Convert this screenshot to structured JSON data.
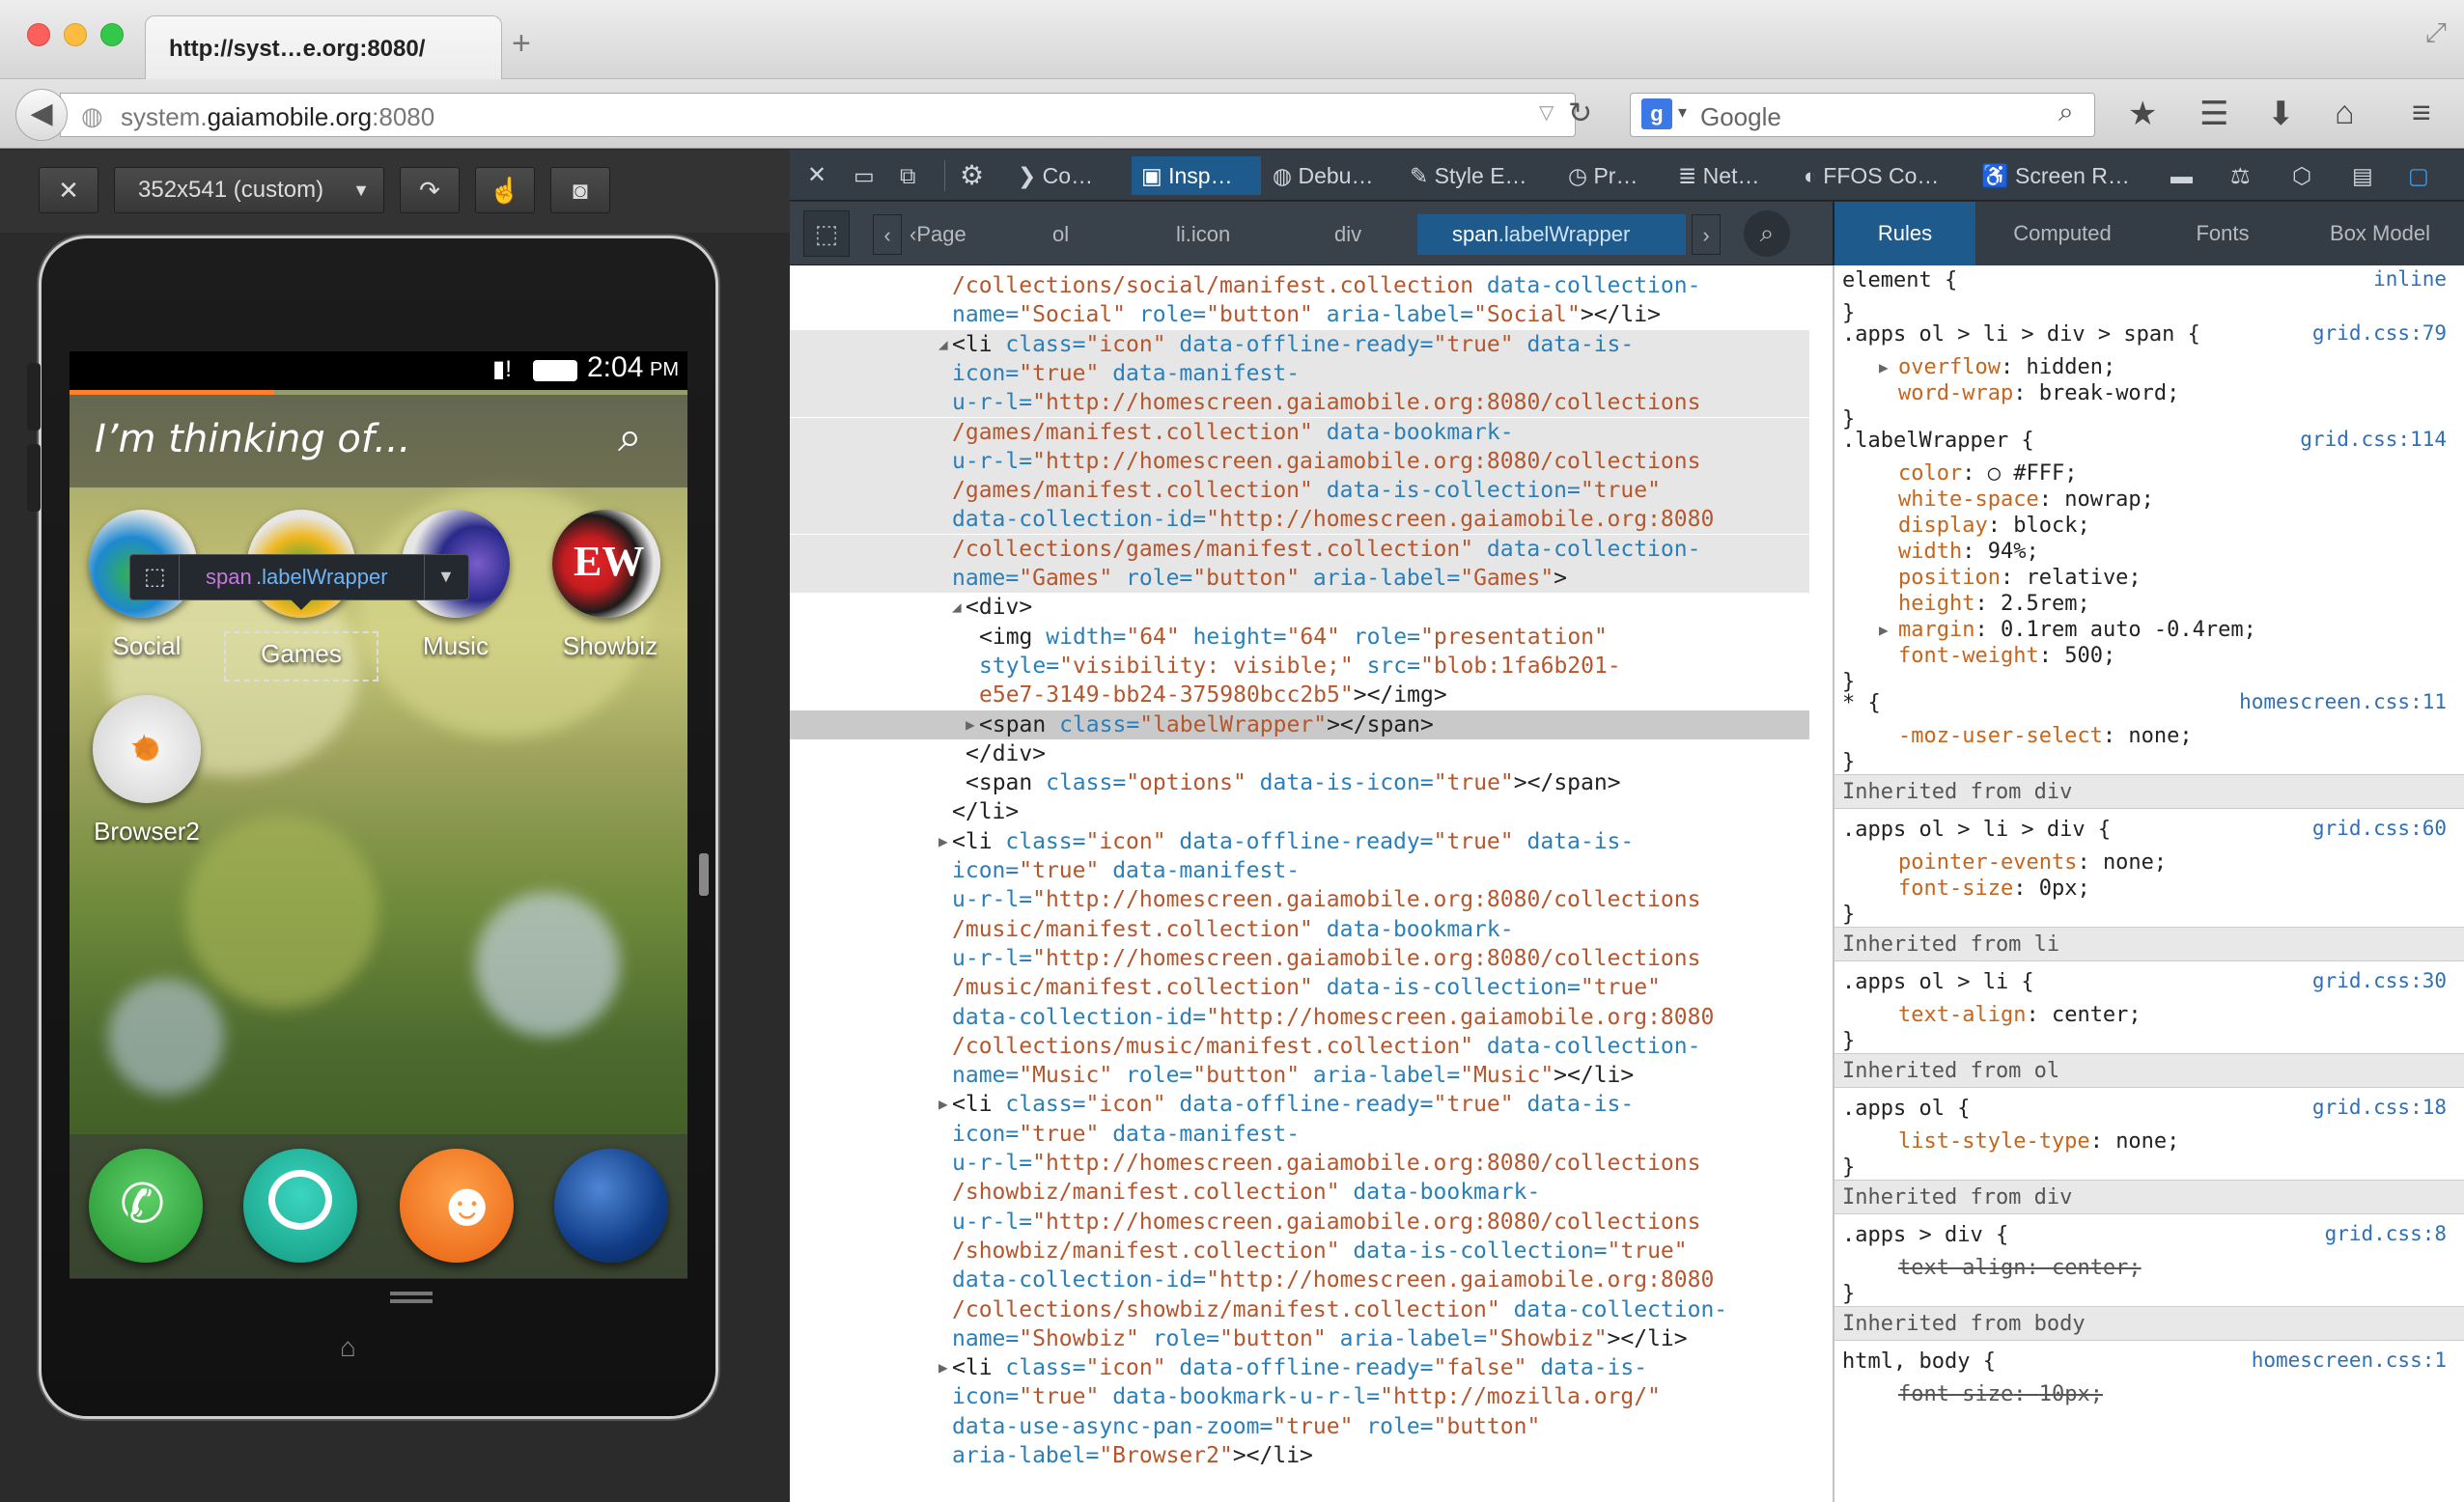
{
  "browser": {
    "tab_title": "http://syst…e.org:8080/",
    "url_prefix": "system.",
    "url_domain": "gaiamobile.org",
    "url_suffix": ":8080",
    "search_placeholder": "Google"
  },
  "responsive": {
    "size_label": "352x541 (custom)"
  },
  "phone": {
    "time": "2:04",
    "ampm": "PM",
    "search_text": "I’m thinking of...",
    "apps": [
      {
        "label": "Social"
      },
      {
        "label": "Games"
      },
      {
        "label": "Music"
      },
      {
        "label": "Showbiz"
      },
      {
        "label": "Browser2"
      }
    ],
    "tooltip_tag": "span",
    "tooltip_class": ".labelWrapper"
  },
  "devtools": {
    "tabs": [
      "Co…",
      "Insp…",
      "Debu…",
      "Style E…",
      "Pr…",
      "Net…",
      "FFOS Co…",
      "Screen R…"
    ],
    "breadcrumbs": [
      "‹Page",
      "ol",
      "li.icon",
      "div",
      "span",
      ".labelWrapper"
    ],
    "rules_tabs": [
      "Rules",
      "Computed",
      "Fonts",
      "Box Model"
    ]
  },
  "markup": [
    {
      "cls": "",
      "segs": [
        [
          "vl",
          "/collections/social/manifest.collection"
        ],
        [
          "at",
          " data-collection-"
        ]
      ]
    },
    {
      "cls": "",
      "segs": [
        [
          "at",
          "name="
        ],
        [
          "vl",
          "\"Social\""
        ],
        [
          "at",
          " role="
        ],
        [
          "vl",
          "\"button\""
        ],
        [
          "at",
          " aria-label="
        ],
        [
          "vl",
          "\"Social\""
        ],
        [
          "tg",
          "></li>"
        ]
      ]
    },
    {
      "cls": "hl",
      "segs": [
        [
          "tg",
          "<li "
        ],
        [
          "at",
          "class="
        ],
        [
          "vl",
          "\"icon\""
        ],
        [
          "at",
          " data-offline-ready="
        ],
        [
          "vl",
          "\"true\""
        ],
        [
          "at",
          " data-is-"
        ]
      ]
    },
    {
      "cls": "hl",
      "segs": [
        [
          "at",
          "icon="
        ],
        [
          "vl",
          "\"true\""
        ],
        [
          "at",
          " data-manifest-"
        ]
      ]
    },
    {
      "cls": "hl",
      "segs": [
        [
          "at",
          "u-r-l="
        ],
        [
          "vl",
          "\"http://homescreen.gaiamobile.org:8080/collections"
        ]
      ]
    },
    {
      "cls": "hl",
      "segs": [
        [
          "vl",
          "/games/manifest.collection\""
        ],
        [
          "at",
          " data-bookmark-"
        ]
      ]
    },
    {
      "cls": "hl",
      "segs": [
        [
          "at",
          "u-r-l="
        ],
        [
          "vl",
          "\"http://homescreen.gaiamobile.org:8080/collections"
        ]
      ]
    },
    {
      "cls": "hl",
      "segs": [
        [
          "vl",
          "/games/manifest.collection\""
        ],
        [
          "at",
          " data-is-collection="
        ],
        [
          "vl",
          "\"true\""
        ]
      ]
    },
    {
      "cls": "hl",
      "segs": [
        [
          "at",
          "data-collection-id="
        ],
        [
          "vl",
          "\"http://homescreen.gaiamobile.org:8080"
        ]
      ]
    },
    {
      "cls": "hl",
      "segs": [
        [
          "vl",
          "/collections/games/manifest.collection\""
        ],
        [
          "at",
          " data-collection-"
        ]
      ]
    },
    {
      "cls": "hl",
      "segs": [
        [
          "at",
          "name="
        ],
        [
          "vl",
          "\"Games\""
        ],
        [
          "at",
          " role="
        ],
        [
          "vl",
          "\"button\""
        ],
        [
          "at",
          " aria-label="
        ],
        [
          "vl",
          "\"Games\""
        ],
        [
          "tg",
          ">"
        ]
      ]
    },
    {
      "cls": "",
      "segs": [
        [
          "tg",
          "<div>"
        ]
      ]
    },
    {
      "cls": "",
      "segs": [
        [
          "tg",
          "<img "
        ],
        [
          "at",
          "width="
        ],
        [
          "vl",
          "\"64\""
        ],
        [
          "at",
          " height="
        ],
        [
          "vl",
          "\"64\""
        ],
        [
          "at",
          " role="
        ],
        [
          "vl",
          "\"presentation\""
        ]
      ]
    },
    {
      "cls": "",
      "segs": [
        [
          "at",
          "style="
        ],
        [
          "vl",
          "\"visibility: visible;\""
        ],
        [
          "at",
          " src="
        ],
        [
          "vl",
          "\"blob:1fa6b201-"
        ]
      ]
    },
    {
      "cls": "",
      "segs": [
        [
          "vl",
          "e5e7-3149-bb24-375980bcc2b5\""
        ],
        [
          "tg",
          "></img>"
        ]
      ]
    },
    {
      "cls": "sel",
      "segs": [
        [
          "tg",
          "<span"
        ],
        [
          "at",
          " class="
        ],
        [
          "vl",
          "\"labelWrapper\""
        ],
        [
          "tg",
          "></span>"
        ]
      ]
    },
    {
      "cls": "",
      "segs": [
        [
          "tg",
          "</div>"
        ]
      ]
    },
    {
      "cls": "",
      "segs": [
        [
          "tg",
          "<span "
        ],
        [
          "at",
          "class="
        ],
        [
          "vl",
          "\"options\""
        ],
        [
          "at",
          " data-is-icon="
        ],
        [
          "vl",
          "\"true\""
        ],
        [
          "tg",
          "></span>"
        ]
      ]
    },
    {
      "cls": "",
      "segs": [
        [
          "tg",
          "</li>"
        ]
      ]
    },
    {
      "cls": "",
      "segs": [
        [
          "tg",
          "<li "
        ],
        [
          "at",
          "class="
        ],
        [
          "vl",
          "\"icon\""
        ],
        [
          "at",
          " data-offline-ready="
        ],
        [
          "vl",
          "\"true\""
        ],
        [
          "at",
          " data-is-"
        ]
      ]
    },
    {
      "cls": "",
      "segs": [
        [
          "at",
          "icon="
        ],
        [
          "vl",
          "\"true\""
        ],
        [
          "at",
          " data-manifest-"
        ]
      ]
    },
    {
      "cls": "",
      "segs": [
        [
          "at",
          "u-r-l="
        ],
        [
          "vl",
          "\"http://homescreen.gaiamobile.org:8080/collections"
        ]
      ]
    },
    {
      "cls": "",
      "segs": [
        [
          "vl",
          "/music/manifest.collection\""
        ],
        [
          "at",
          " data-bookmark-"
        ]
      ]
    },
    {
      "cls": "",
      "segs": [
        [
          "at",
          "u-r-l="
        ],
        [
          "vl",
          "\"http://homescreen.gaiamobile.org:8080/collections"
        ]
      ]
    },
    {
      "cls": "",
      "segs": [
        [
          "vl",
          "/music/manifest.collection\""
        ],
        [
          "at",
          " data-is-collection="
        ],
        [
          "vl",
          "\"true\""
        ]
      ]
    },
    {
      "cls": "",
      "segs": [
        [
          "at",
          "data-collection-id="
        ],
        [
          "vl",
          "\"http://homescreen.gaiamobile.org:8080"
        ]
      ]
    },
    {
      "cls": "",
      "segs": [
        [
          "vl",
          "/collections/music/manifest.collection\""
        ],
        [
          "at",
          " data-collection-"
        ]
      ]
    },
    {
      "cls": "",
      "segs": [
        [
          "at",
          "name="
        ],
        [
          "vl",
          "\"Music\""
        ],
        [
          "at",
          " role="
        ],
        [
          "vl",
          "\"button\""
        ],
        [
          "at",
          " aria-label="
        ],
        [
          "vl",
          "\"Music\""
        ],
        [
          "tg",
          "></li>"
        ]
      ]
    },
    {
      "cls": "",
      "segs": [
        [
          "tg",
          "<li "
        ],
        [
          "at",
          "class="
        ],
        [
          "vl",
          "\"icon\""
        ],
        [
          "at",
          " data-offline-ready="
        ],
        [
          "vl",
          "\"true\""
        ],
        [
          "at",
          " data-is-"
        ]
      ]
    },
    {
      "cls": "",
      "segs": [
        [
          "at",
          "icon="
        ],
        [
          "vl",
          "\"true\""
        ],
        [
          "at",
          " data-manifest-"
        ]
      ]
    },
    {
      "cls": "",
      "segs": [
        [
          "at",
          "u-r-l="
        ],
        [
          "vl",
          "\"http://homescreen.gaiamobile.org:8080/collections"
        ]
      ]
    },
    {
      "cls": "",
      "segs": [
        [
          "vl",
          "/showbiz/manifest.collection\""
        ],
        [
          "at",
          " data-bookmark-"
        ]
      ]
    },
    {
      "cls": "",
      "segs": [
        [
          "at",
          "u-r-l="
        ],
        [
          "vl",
          "\"http://homescreen.gaiamobile.org:8080/collections"
        ]
      ]
    },
    {
      "cls": "",
      "segs": [
        [
          "vl",
          "/showbiz/manifest.collection\""
        ],
        [
          "at",
          " data-is-collection="
        ],
        [
          "vl",
          "\"true\""
        ]
      ]
    },
    {
      "cls": "",
      "segs": [
        [
          "at",
          "data-collection-id="
        ],
        [
          "vl",
          "\"http://homescreen.gaiamobile.org:8080"
        ]
      ]
    },
    {
      "cls": "",
      "segs": [
        [
          "vl",
          "/collections/showbiz/manifest.collection\""
        ],
        [
          "at",
          " data-collection-"
        ]
      ]
    },
    {
      "cls": "",
      "segs": [
        [
          "at",
          "name="
        ],
        [
          "vl",
          "\"Showbiz\""
        ],
        [
          "at",
          " role="
        ],
        [
          "vl",
          "\"button\""
        ],
        [
          "at",
          " aria-label="
        ],
        [
          "vl",
          "\"Showbiz\""
        ],
        [
          "tg",
          "></li>"
        ]
      ]
    },
    {
      "cls": "",
      "segs": [
        [
          "tg",
          "<li "
        ],
        [
          "at",
          "class="
        ],
        [
          "vl",
          "\"icon\""
        ],
        [
          "at",
          " data-offline-ready="
        ],
        [
          "vl",
          "\"false\""
        ],
        [
          "at",
          " data-is-"
        ]
      ]
    },
    {
      "cls": "",
      "segs": [
        [
          "at",
          "icon="
        ],
        [
          "vl",
          "\"true\""
        ],
        [
          "at",
          " data-bookmark-u-r-l="
        ],
        [
          "vl",
          "\"http://mozilla.org/\""
        ]
      ]
    },
    {
      "cls": "",
      "segs": [
        [
          "at",
          "data-use-async-pan-zoom="
        ],
        [
          "vl",
          "\"true\""
        ],
        [
          "at",
          " role="
        ],
        [
          "vl",
          "\"button\""
        ]
      ]
    },
    {
      "cls": "",
      "segs": [
        [
          "at",
          "aria-label="
        ],
        [
          "vl",
          "\"Browser2\""
        ],
        [
          "tg",
          "></li>"
        ]
      ]
    }
  ],
  "rules": [
    {
      "kind": "sel",
      "text": "element {",
      "src": "inline"
    },
    {
      "kind": "close",
      "text": "}"
    },
    {
      "kind": "sel",
      "text": ".apps ol > li > div > span {",
      "src": "grid.css:79"
    },
    {
      "kind": "prop",
      "name": "overflow",
      "value": "hidden;"
    },
    {
      "kind": "prop",
      "name": "word-wrap",
      "value": "break-word;"
    },
    {
      "kind": "close",
      "text": "}"
    },
    {
      "kind": "sel",
      "text": ".labelWrapper {",
      "src": "grid.css:114"
    },
    {
      "kind": "prop",
      "name": "color",
      "value": "○ #FFF;"
    },
    {
      "kind": "prop",
      "name": "white-space",
      "value": "nowrap;"
    },
    {
      "kind": "prop",
      "name": "display",
      "value": "block;"
    },
    {
      "kind": "prop",
      "name": "width",
      "value": "94%;"
    },
    {
      "kind": "prop",
      "name": "position",
      "value": "relative;"
    },
    {
      "kind": "prop",
      "name": "height",
      "value": "2.5rem;"
    },
    {
      "kind": "prop",
      "name": "margin",
      "value": "0.1rem auto -0.4rem;"
    },
    {
      "kind": "prop",
      "name": "font-weight",
      "value": "500;"
    },
    {
      "kind": "close",
      "text": "}"
    },
    {
      "kind": "sel",
      "text": "* {",
      "src": "homescreen.css:11"
    },
    {
      "kind": "prop",
      "name": "-moz-user-select",
      "value": "none;"
    },
    {
      "kind": "close",
      "text": "}"
    },
    {
      "kind": "inh",
      "text": "Inherited from div"
    },
    {
      "kind": "sel",
      "text": ".apps ol > li > div {",
      "src": "grid.css:60"
    },
    {
      "kind": "prop",
      "name": "pointer-events",
      "value": "none;"
    },
    {
      "kind": "prop",
      "name": "font-size",
      "value": "0px;"
    },
    {
      "kind": "close",
      "text": "}"
    },
    {
      "kind": "inh",
      "text": "Inherited from li"
    },
    {
      "kind": "sel",
      "text": ".apps ol > li {",
      "src": "grid.css:30"
    },
    {
      "kind": "prop",
      "name": "text-align",
      "value": "center;"
    },
    {
      "kind": "close",
      "text": "}"
    },
    {
      "kind": "inh",
      "text": "Inherited from ol"
    },
    {
      "kind": "sel",
      "text": ".apps ol {",
      "src": "grid.css:18"
    },
    {
      "kind": "prop",
      "name": "list-style-type",
      "value": "none;"
    },
    {
      "kind": "close",
      "text": "}"
    },
    {
      "kind": "inh",
      "text": "Inherited from div"
    },
    {
      "kind": "sel",
      "text": ".apps > div {",
      "src": "grid.css:8"
    },
    {
      "kind": "strike",
      "name": "text-align",
      "value": "center;"
    },
    {
      "kind": "close",
      "text": "}"
    },
    {
      "kind": "inh",
      "text": "Inherited from body"
    },
    {
      "kind": "sel",
      "text": "html, body {",
      "src": "homescreen.css:1"
    },
    {
      "kind": "strike",
      "name": "font-size",
      "value": "10px;"
    }
  ]
}
